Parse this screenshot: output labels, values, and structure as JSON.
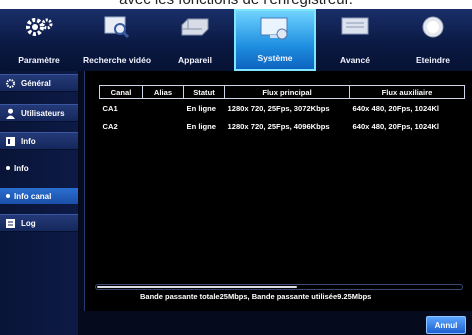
{
  "caption": "avec les fonctions de l'enregistreur.",
  "topnav": {
    "tabs": [
      {
        "label": "Paramètre",
        "icon": "gear-icon"
      },
      {
        "label": "Recherche vidéo",
        "icon": "video-search-icon"
      },
      {
        "label": "Appareil",
        "icon": "hard-drive-icon"
      },
      {
        "label": "Système",
        "icon": "monitor-icon",
        "active": true
      },
      {
        "label": "Avancé",
        "icon": "settings-panel-icon"
      },
      {
        "label": "Eteindre",
        "icon": "power-icon"
      }
    ]
  },
  "sidebar": {
    "general": "Général",
    "users": "Utilisateurs",
    "info": "Info",
    "info_sub": "Info",
    "info_canal": "Info canal",
    "log": "Log"
  },
  "table": {
    "headers": [
      "Canal",
      "Alias",
      "Statut",
      "Flux principal",
      "Flux auxiliaire"
    ],
    "rows": [
      [
        "CA1",
        "",
        "En ligne",
        "1280x 720,  25Fps,  3072Kbps",
        "640x 480,  20Fps,  1024Kl"
      ],
      [
        "CA2",
        "",
        "En ligne",
        "1280x 720,  25Fps,  4096Kbps",
        "640x 480,  20Fps,  1024Kl"
      ]
    ]
  },
  "bandwidth": "Bande passante totale25Mbps, Bande passante utilisée9.25Mbps",
  "cancel_label": "Annul",
  "colors": {
    "accent": "#1f8fe0",
    "background": "#050a1c"
  }
}
